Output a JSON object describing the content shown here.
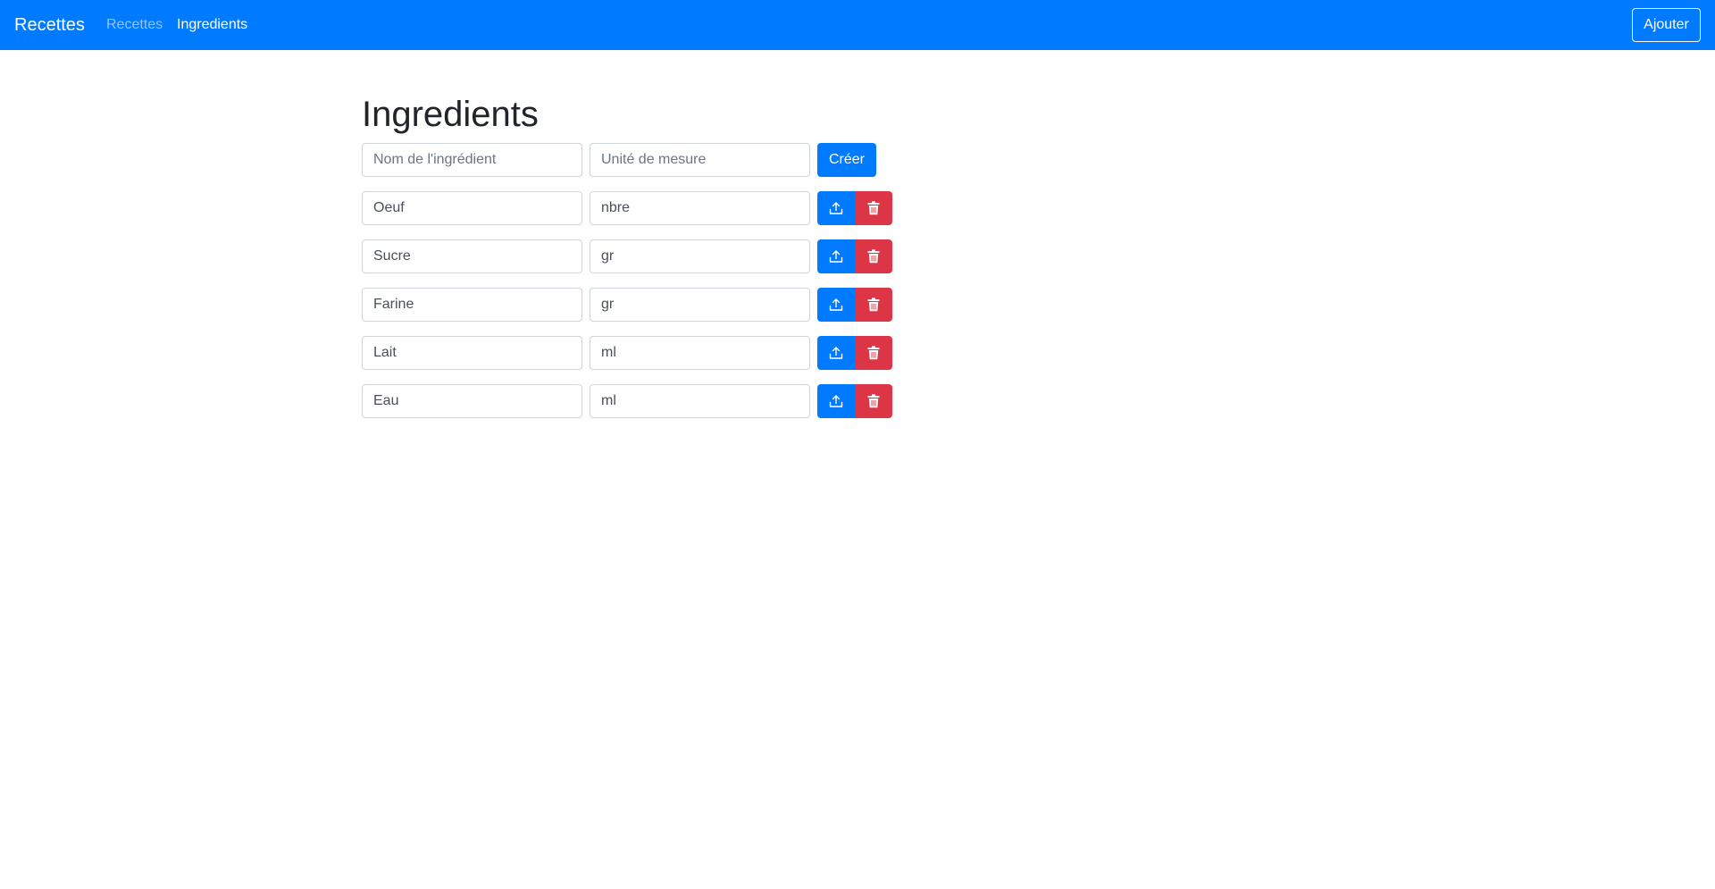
{
  "navbar": {
    "brand": "Recettes",
    "links": [
      {
        "label": "Recettes",
        "active": false
      },
      {
        "label": "Ingredients",
        "active": true
      }
    ],
    "add_button": "Ajouter"
  },
  "page": {
    "title": "Ingredients"
  },
  "create_form": {
    "name_placeholder": "Nom de l'ingrédient",
    "unit_placeholder": "Unité de mesure",
    "create_button": "Créer"
  },
  "ingredients": [
    {
      "name": "Oeuf",
      "unit": "nbre"
    },
    {
      "name": "Sucre",
      "unit": "gr"
    },
    {
      "name": "Farine",
      "unit": "gr"
    },
    {
      "name": "Lait",
      "unit": "ml"
    },
    {
      "name": "Eau",
      "unit": "ml"
    }
  ],
  "icons": {
    "update": "upload-icon",
    "delete": "trash-icon"
  },
  "colors": {
    "primary": "#007bff",
    "danger": "#dc3545"
  }
}
